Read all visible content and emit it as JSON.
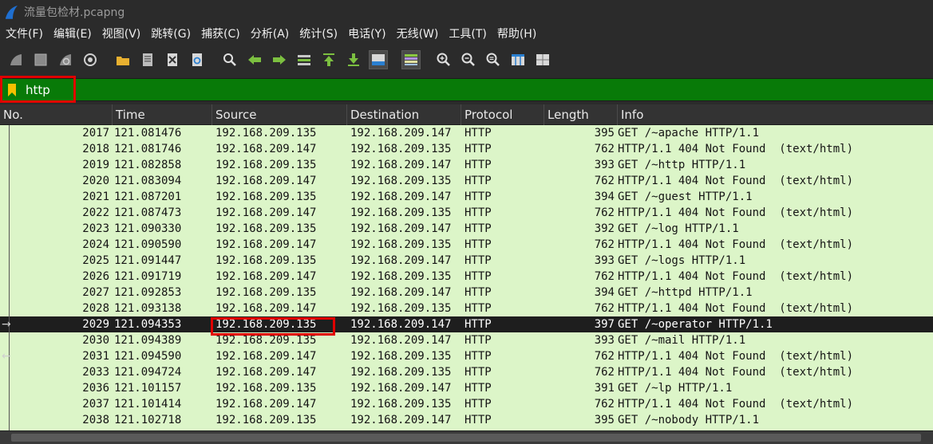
{
  "window": {
    "title": "流量包检材.pcapng"
  },
  "menu": [
    "文件(F)",
    "编辑(E)",
    "视图(V)",
    "跳转(G)",
    "捕获(C)",
    "分析(A)",
    "统计(S)",
    "电话(Y)",
    "无线(W)",
    "工具(T)",
    "帮助(H)"
  ],
  "toolbar_icons": [
    "start-capture-icon",
    "stop-capture-icon",
    "restart-capture-icon",
    "capture-options-icon",
    "open-file-icon",
    "save-file-icon",
    "close-file-icon",
    "reload-file-icon",
    "find-packet-icon",
    "go-back-icon",
    "go-forward-icon",
    "go-to-packet-icon",
    "go-first-icon",
    "go-last-icon",
    "autoscroll-icon",
    "colorize-icon",
    "zoom-in-icon",
    "zoom-out-icon",
    "zoom-normal-icon",
    "resize-columns-icon",
    "layout-icon"
  ],
  "filter": {
    "value": "http"
  },
  "columns": [
    "No.",
    "Time",
    "Source",
    "Destination",
    "Protocol",
    "Length",
    "Info"
  ],
  "packets": [
    {
      "no": "2017",
      "time": "121.081476",
      "src": "192.168.209.135",
      "dst": "192.168.209.147",
      "proto": "HTTP",
      "len": "395",
      "info": "GET /~apache HTTP/1.1"
    },
    {
      "no": "2018",
      "time": "121.081746",
      "src": "192.168.209.147",
      "dst": "192.168.209.135",
      "proto": "HTTP",
      "len": "762",
      "info": "HTTP/1.1 404 Not Found  (text/html)"
    },
    {
      "no": "2019",
      "time": "121.082858",
      "src": "192.168.209.135",
      "dst": "192.168.209.147",
      "proto": "HTTP",
      "len": "393",
      "info": "GET /~http HTTP/1.1"
    },
    {
      "no": "2020",
      "time": "121.083094",
      "src": "192.168.209.147",
      "dst": "192.168.209.135",
      "proto": "HTTP",
      "len": "762",
      "info": "HTTP/1.1 404 Not Found  (text/html)"
    },
    {
      "no": "2021",
      "time": "121.087201",
      "src": "192.168.209.135",
      "dst": "192.168.209.147",
      "proto": "HTTP",
      "len": "394",
      "info": "GET /~guest HTTP/1.1"
    },
    {
      "no": "2022",
      "time": "121.087473",
      "src": "192.168.209.147",
      "dst": "192.168.209.135",
      "proto": "HTTP",
      "len": "762",
      "info": "HTTP/1.1 404 Not Found  (text/html)"
    },
    {
      "no": "2023",
      "time": "121.090330",
      "src": "192.168.209.135",
      "dst": "192.168.209.147",
      "proto": "HTTP",
      "len": "392",
      "info": "GET /~log HTTP/1.1"
    },
    {
      "no": "2024",
      "time": "121.090590",
      "src": "192.168.209.147",
      "dst": "192.168.209.135",
      "proto": "HTTP",
      "len": "762",
      "info": "HTTP/1.1 404 Not Found  (text/html)"
    },
    {
      "no": "2025",
      "time": "121.091447",
      "src": "192.168.209.135",
      "dst": "192.168.209.147",
      "proto": "HTTP",
      "len": "393",
      "info": "GET /~logs HTTP/1.1"
    },
    {
      "no": "2026",
      "time": "121.091719",
      "src": "192.168.209.147",
      "dst": "192.168.209.135",
      "proto": "HTTP",
      "len": "762",
      "info": "HTTP/1.1 404 Not Found  (text/html)"
    },
    {
      "no": "2027",
      "time": "121.092853",
      "src": "192.168.209.135",
      "dst": "192.168.209.147",
      "proto": "HTTP",
      "len": "394",
      "info": "GET /~httpd HTTP/1.1"
    },
    {
      "no": "2028",
      "time": "121.093138",
      "src": "192.168.209.147",
      "dst": "192.168.209.135",
      "proto": "HTTP",
      "len": "762",
      "info": "HTTP/1.1 404 Not Found  (text/html)"
    },
    {
      "no": "2029",
      "time": "121.094353",
      "src": "192.168.209.135",
      "dst": "192.168.209.147",
      "proto": "HTTP",
      "len": "397",
      "info": "GET /~operator HTTP/1.1",
      "selected": true
    },
    {
      "no": "2030",
      "time": "121.094389",
      "src": "192.168.209.135",
      "dst": "192.168.209.147",
      "proto": "HTTP",
      "len": "393",
      "info": "GET /~mail HTTP/1.1"
    },
    {
      "no": "2031",
      "time": "121.094590",
      "src": "192.168.209.147",
      "dst": "192.168.209.135",
      "proto": "HTTP",
      "len": "762",
      "info": "HTTP/1.1 404 Not Found  (text/html)"
    },
    {
      "no": "2033",
      "time": "121.094724",
      "src": "192.168.209.147",
      "dst": "192.168.209.135",
      "proto": "HTTP",
      "len": "762",
      "info": "HTTP/1.1 404 Not Found  (text/html)"
    },
    {
      "no": "2036",
      "time": "121.101157",
      "src": "192.168.209.135",
      "dst": "192.168.209.147",
      "proto": "HTTP",
      "len": "391",
      "info": "GET /~lp HTTP/1.1"
    },
    {
      "no": "2037",
      "time": "121.101414",
      "src": "192.168.209.147",
      "dst": "192.168.209.135",
      "proto": "HTTP",
      "len": "762",
      "info": "HTTP/1.1 404 Not Found  (text/html)"
    },
    {
      "no": "2038",
      "time": "121.102718",
      "src": "192.168.209.135",
      "dst": "192.168.209.147",
      "proto": "HTTP",
      "len": "395",
      "info": "GET /~nobody HTTP/1.1"
    }
  ],
  "colors": {
    "row_bg": "#dcf5c8",
    "selected_bg": "#1e1e1e",
    "filter_bg": "#087a08",
    "highlight": "#e00000"
  }
}
